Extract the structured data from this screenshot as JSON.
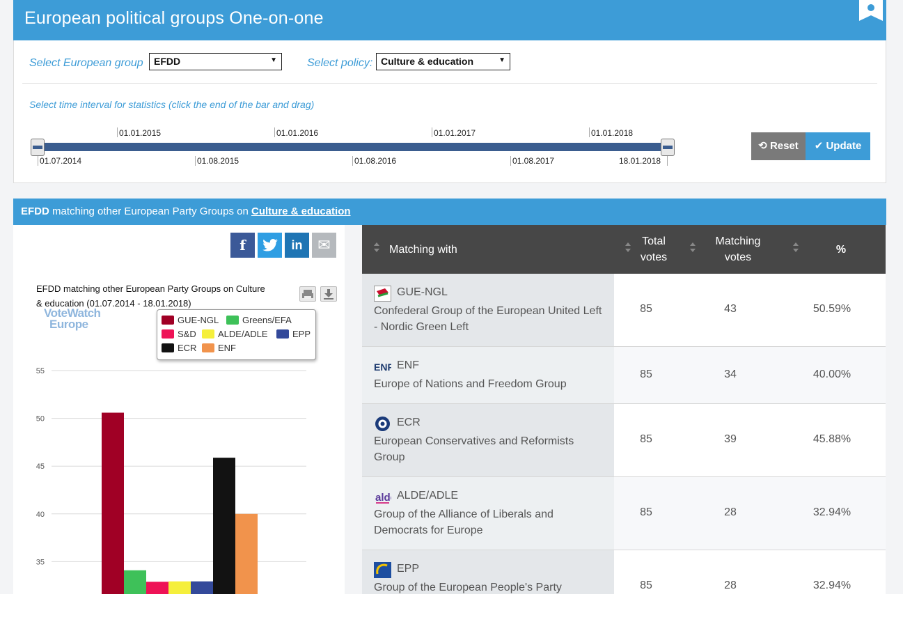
{
  "header": {
    "title": "European political groups  One-on-one"
  },
  "filters": {
    "group_label": "Select European group",
    "group_value": "EFDD",
    "policy_label": "Select policy:",
    "policy_value": "Culture & education",
    "interval_label": "Select time interval for statistics (click the end of the bar and drag)",
    "timeline_top_ticks": [
      "01.01.2015",
      "01.01.2016",
      "01.01.2017",
      "01.01.2018"
    ],
    "timeline_bottom_ticks": [
      "01.07.2014",
      "01.08.2015",
      "01.08.2016",
      "01.08.2017",
      "18.01.2018"
    ],
    "reset_label": "Reset",
    "update_label": "Update"
  },
  "section": {
    "group": "EFDD",
    "middle": " matching other European Party Groups on ",
    "policy": "Culture & education"
  },
  "share": {
    "facebook": "f",
    "twitter": "t",
    "linkedin": "in",
    "email": "✉"
  },
  "logo": {
    "line1": "VoteWatch",
    "line2": "Europe"
  },
  "chart_data": {
    "type": "bar",
    "title": "EFDD matching other European Party Groups on Culture & education (01.07.2014 - 18.01.2018)",
    "categories": [
      "GUE-NGL",
      "Greens/EFA",
      "S&D",
      "ALDE/ADLE",
      "EPP",
      "ECR",
      "ENF"
    ],
    "values": [
      50.59,
      34.1,
      32.9,
      32.94,
      32.94,
      45.88,
      40.0
    ],
    "colors": [
      "#a00025",
      "#3ec159",
      "#ee1256",
      "#f5ef3b",
      "#33499a",
      "#121212",
      "#f1934c"
    ],
    "yticks": [
      35,
      40,
      45,
      50,
      55
    ],
    "ylim": [
      31.7,
      55
    ],
    "legend_position": "top-right",
    "grid": true
  },
  "table": {
    "headers": {
      "matching": "Matching with",
      "total": "Total\nvotes",
      "match": "Matching\nvotes",
      "pct": "%"
    },
    "rows": [
      {
        "code": "GUE-NGL",
        "name": "Confederal Group of the European United Left - Nordic Green Left",
        "total": "85",
        "matching": "43",
        "pct": "50.59%"
      },
      {
        "code": "ENF",
        "name": "Europe of Nations and Freedom Group",
        "total": "85",
        "matching": "34",
        "pct": "40.00%"
      },
      {
        "code": "ECR",
        "name": "European Conservatives and Reformists Group",
        "total": "85",
        "matching": "39",
        "pct": "45.88%"
      },
      {
        "code": "ALDE/ADLE",
        "name": "Group of the Alliance of Liberals and Democrats for Europe",
        "total": "85",
        "matching": "28",
        "pct": "32.94%"
      },
      {
        "code": "EPP",
        "name": "Group of the European People's Party",
        "total": "85",
        "matching": "28",
        "pct": "32.94%"
      }
    ]
  }
}
